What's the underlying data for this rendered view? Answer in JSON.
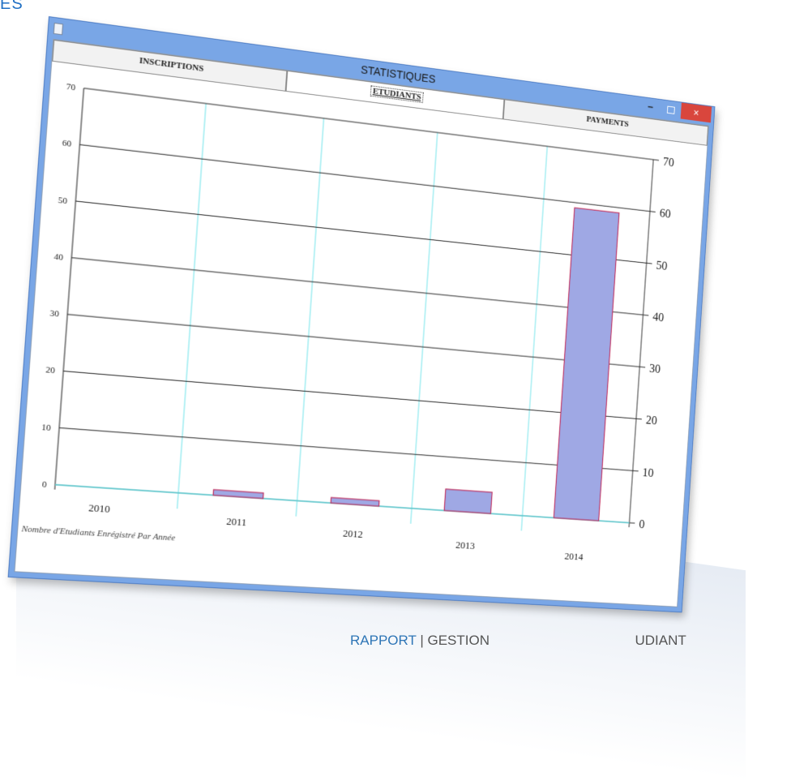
{
  "corner_text": "ES",
  "window": {
    "title": "STATISTIQUES",
    "minimize_label": "–",
    "close_label": "×"
  },
  "tabs": [
    {
      "label": "INSCRIPTIONS",
      "active": false
    },
    {
      "label": "ETUDIANTS",
      "active": true
    },
    {
      "label": "PAYMENTS",
      "active": false
    }
  ],
  "chart_data": {
    "type": "bar",
    "title": "",
    "xlabel": "Nombre d'Etudiants Enrégistré Par Année",
    "ylabel": "",
    "categories": [
      "2010",
      "2011",
      "2012",
      "2013",
      "2014"
    ],
    "values": [
      0,
      1,
      1,
      4,
      59
    ],
    "ylim": [
      0,
      70
    ],
    "yticks": [
      0,
      10,
      20,
      30,
      40,
      50,
      60,
      70
    ],
    "grid": true,
    "bar_color": "#9fa8e4",
    "bar_edge_color": "#c0305f",
    "vgrid_color": "#6fe3ea"
  },
  "footer": {
    "accent": "RAPPORT",
    "separator": "|",
    "left_text": "GESTION",
    "right_text": "UDIANT"
  }
}
